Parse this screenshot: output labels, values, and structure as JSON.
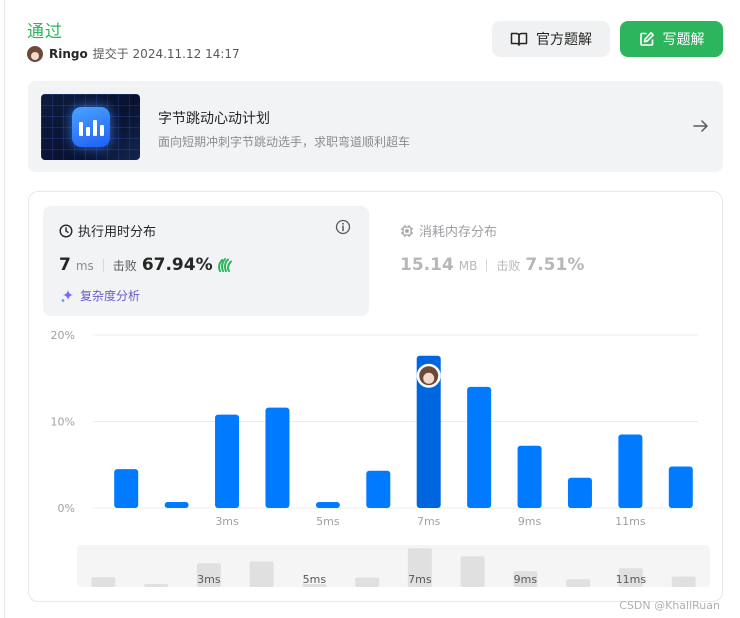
{
  "header": {
    "status": "通过",
    "user": "Ringo",
    "submitted_label": "提交于 2024.11.12 14:17",
    "official_solution_label": "官方题解",
    "write_solution_label": "写题解"
  },
  "banner": {
    "title": "字节跳动心动计划",
    "subtitle": "面向短期冲刺字节跳动选手，求职弯道顺利超车"
  },
  "runtime": {
    "title": "执行用时分布",
    "value": "7",
    "unit": "ms",
    "beat_label": "击败",
    "beat_value": "67.94%",
    "complexity_label": "复杂度分析"
  },
  "memory": {
    "title": "消耗内存分布",
    "value": "15.14",
    "unit": "MB",
    "beat_label": "击败",
    "beat_value": "7.51%"
  },
  "colors": {
    "accent_green": "#2db55d",
    "bar": "#007aff",
    "bar_active": "#0066e0",
    "nav_bar": "#e0e0e0"
  },
  "chart_data": {
    "type": "bar",
    "title": "",
    "xlabel": "",
    "ylabel": "",
    "ylim": [
      0,
      20
    ],
    "yticks": [
      "0%",
      "10%",
      "20%"
    ],
    "categories": [
      "1ms",
      "2ms",
      "3ms",
      "4ms",
      "5ms",
      "6ms",
      "7ms",
      "8ms",
      "9ms",
      "10ms",
      "11ms",
      "12ms"
    ],
    "xtick_labels": [
      "",
      "",
      "3ms",
      "",
      "5ms",
      "",
      "7ms",
      "",
      "9ms",
      "",
      "11ms",
      ""
    ],
    "values": [
      4.5,
      0.7,
      10.8,
      11.6,
      0.7,
      4.3,
      17.6,
      14.0,
      7.2,
      3.5,
      8.5,
      4.8
    ],
    "highlight_index": 6,
    "grid": true
  },
  "watermark": "CSDN @KhallRuan"
}
